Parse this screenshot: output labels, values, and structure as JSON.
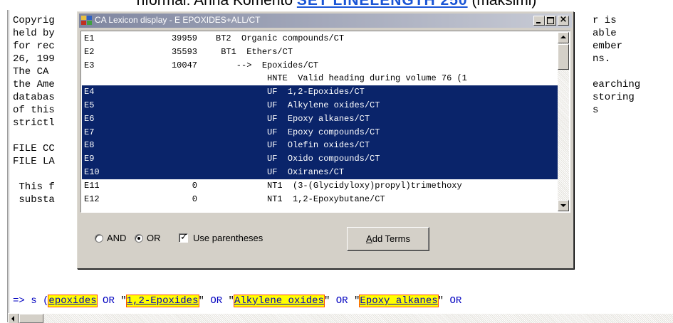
{
  "heading": {
    "text_before": "nformal: Anna Komento",
    "link_text": "SET LINELENGTH 250",
    "text_after": "(maksimi)"
  },
  "terminal": {
    "left_lines": [
      "Copyrig",
      "held by",
      "for rec",
      "26, 199",
      "The CA ",
      "the Ame",
      "databas",
      "of this",
      "strictl",
      "",
      "FILE CC",
      "FILE LA",
      "",
      " This f",
      " substa"
    ],
    "right_lines": [
      "r is",
      "able",
      "ember",
      "ns.",
      "",
      "earching",
      "storing",
      "s",
      "",
      "",
      "",
      "",
      "",
      "",
      ""
    ]
  },
  "command": {
    "prompt": "=> s (",
    "terms": [
      "epoxides",
      "1,2-Epoxides",
      "Alkylene oxides",
      "Epoxy alkanes"
    ],
    "op": "OR"
  },
  "dialog": {
    "title": "CA Lexicon display - E EPOXIDES+ALL/CT",
    "rows": [
      {
        "id": "E1",
        "num": "39959",
        "code": "BT2",
        "text": "Organic compounds/CT",
        "selected": false
      },
      {
        "id": "E2",
        "num": "35593",
        "code": " BT1",
        "text": "Ethers/CT",
        "selected": false
      },
      {
        "id": "E3",
        "num": "10047",
        "code": "    -->",
        "text": "Epoxides/CT",
        "selected": false
      },
      {
        "id": "",
        "num": "",
        "code": "          HNTE",
        "text": "Valid heading during volume 76 (1",
        "selected": false
      },
      {
        "id": "E4",
        "num": "",
        "code": "          UF",
        "text": "1,2-Epoxides/CT",
        "selected": true
      },
      {
        "id": "E5",
        "num": "",
        "code": "          UF",
        "text": "Alkylene oxides/CT",
        "selected": true
      },
      {
        "id": "E6",
        "num": "",
        "code": "          UF",
        "text": "Epoxy alkanes/CT",
        "selected": true
      },
      {
        "id": "E7",
        "num": "",
        "code": "          UF",
        "text": "Epoxy compounds/CT",
        "selected": true
      },
      {
        "id": "E8",
        "num": "",
        "code": "          UF",
        "text": "Olefin oxides/CT",
        "selected": true
      },
      {
        "id": "E9",
        "num": "",
        "code": "          UF",
        "text": "Oxido compounds/CT",
        "selected": true
      },
      {
        "id": "E10",
        "num": "",
        "code": "          UF",
        "text": "Oxiranes/CT",
        "selected": true
      },
      {
        "id": "E11",
        "num": "0",
        "code": "          NT1",
        "text": "(3-(Glycidyloxy)propyl)trimethoxy",
        "selected": false
      },
      {
        "id": "E12",
        "num": "0",
        "code": "          NT1",
        "text": "1,2-Epoxybutane/CT",
        "selected": false
      }
    ],
    "and_label": "AND",
    "or_label": "OR",
    "selected_operator": "OR",
    "parentheses_label": "Use parentheses",
    "parentheses_checked": true,
    "add_button_ul": "A",
    "add_button_rest": "dd Terms"
  }
}
